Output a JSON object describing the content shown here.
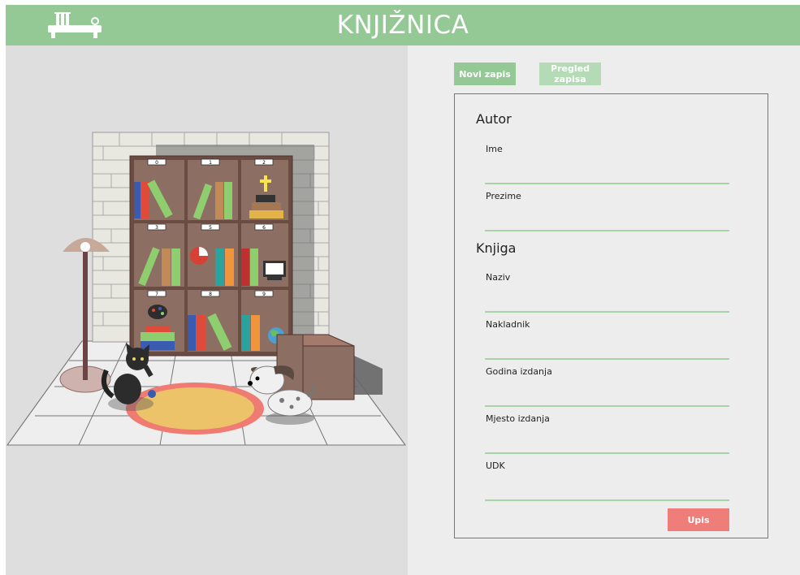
{
  "header": {
    "title": "KNJIŽNICA",
    "logo_icon": "bookshelf-icon"
  },
  "tabs": [
    {
      "label": "Novi zapis",
      "active": true
    },
    {
      "label": "Pregled zapisa",
      "active": false
    }
  ],
  "form": {
    "author_section": "Autor",
    "book_section": "Knjiga",
    "fields": {
      "first_name": {
        "label": "Ime",
        "value": ""
      },
      "last_name": {
        "label": "Prezime",
        "value": ""
      },
      "title": {
        "label": "Naziv",
        "value": ""
      },
      "publisher": {
        "label": "Nakladnik",
        "value": ""
      },
      "year": {
        "label": "Godina izdanja",
        "value": ""
      },
      "place": {
        "label": "Mjesto izdanja",
        "value": ""
      },
      "udk": {
        "label": "UDK",
        "value": ""
      }
    },
    "submit_label": "Upis"
  },
  "shelf_labels": [
    "0",
    "1",
    "2",
    "3",
    "5",
    "6",
    "7",
    "8",
    "9"
  ],
  "colors": {
    "accent": "#94c995",
    "submit": "#ef7d7a",
    "tab_inactive": "#b4dbb5"
  }
}
